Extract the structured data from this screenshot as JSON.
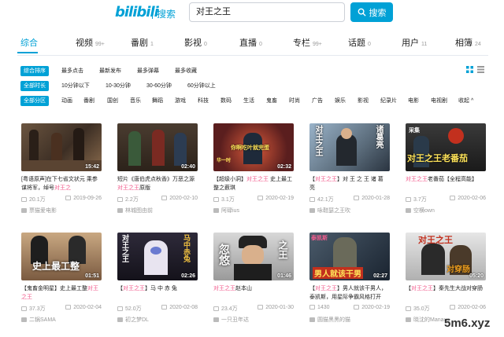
{
  "header": {
    "logo": "bilibili",
    "logo_sub": "搜索",
    "search_value": "对王之王",
    "search_button": "搜索"
  },
  "tabs": [
    {
      "label": "综合",
      "count": ""
    },
    {
      "label": "视频",
      "count": "99+"
    },
    {
      "label": "番剧",
      "count": "1"
    },
    {
      "label": "影视",
      "count": "0"
    },
    {
      "label": "直播",
      "count": "0"
    },
    {
      "label": "专栏",
      "count": "99+"
    },
    {
      "label": "话题",
      "count": "0"
    },
    {
      "label": "用户",
      "count": "11"
    },
    {
      "label": "相簿",
      "count": "24"
    }
  ],
  "filters": {
    "sort": [
      "综合排序",
      "最多点击",
      "最新发布",
      "最多弹幕",
      "最多收藏"
    ],
    "duration": [
      "全部时长",
      "10分钟以下",
      "10-30分钟",
      "30-60分钟",
      "60分钟以上"
    ],
    "zone": [
      "全部分区",
      "动画",
      "番剧",
      "国创",
      "音乐",
      "舞蹈",
      "游戏",
      "科技",
      "数码",
      "生活",
      "鬼畜",
      "时尚",
      "广告",
      "娱乐",
      "影视",
      "纪录片",
      "电影",
      "电视剧",
      "收起 ^"
    ]
  },
  "videos": [
    {
      "duration": "15:42",
      "title_pre": "[粤语原声]在下七省文状元 乘参谋将军，绰号",
      "title_hl": "对王之",
      "title_post": "",
      "views": "20.1万",
      "date": "2019-09-26",
      "uploader": "票猫爱电影",
      "overlay": ""
    },
    {
      "duration": "02:40",
      "title_pre": "短片《唐伯虎点秋香》万恶之源",
      "title_hl": "对王之王",
      "title_post": "原版",
      "views": "2.2万",
      "date": "2020-02-10",
      "uploader": "林城图由前",
      "overlay": "",
      "overlay2": ""
    },
    {
      "duration": "02:32",
      "title_pre": "【超级小洞】",
      "title_hl": "对王之王",
      "title_post": " 史上最工整之薮琪",
      "views": "3.1万",
      "date": "2020-02-19",
      "uploader": "阿碌ius",
      "overlay": "你啊吃叶就完蛋",
      "overlay2": "华一时"
    },
    {
      "duration": "",
      "title_pre": "【",
      "title_hl": "对王之王",
      "title_post": "】对 王 之 王 诸 葛 亮",
      "views": "42.1万",
      "date": "2020-01-28",
      "uploader": "咏鞋瑟之王吹",
      "overlay": "对王之王",
      "overlay2": "诸葛亮"
    },
    {
      "duration": "",
      "title_pre": "",
      "title_hl": "对王之王",
      "title_post": "老番茄【全程高能】",
      "views": "3.7万",
      "date": "2020-02-06",
      "uploader": "空横own",
      "overlay": "对王之王老番茄",
      "overlay2": "采集"
    },
    {
      "duration": "01:51",
      "title_pre": "【鬼畜金明星】史上最工整",
      "title_hl": "对王之王",
      "title_post": "",
      "views": "37.3万",
      "date": "2020-02-04",
      "uploader": "二锅SAMA",
      "overlay": "史上最工整"
    },
    {
      "duration": "02:26",
      "title_pre": "【",
      "title_hl": "对王之王",
      "title_post": "】马 中 赤 兔",
      "views": "52.0万",
      "date": "2020-02-08",
      "uploader": "初之梦DL",
      "overlay": "对王之王",
      "overlay2": "马中赤兔"
    },
    {
      "duration": "01:46",
      "title_pre": "",
      "title_hl": "对王之王",
      "title_post": "赵本山",
      "views": "23.4万",
      "date": "2020-01-30",
      "uploader": "一只丑年达",
      "overlay": "忽悠",
      "overlay2": "之王"
    },
    {
      "duration": "02:27",
      "title_pre": "【",
      "title_hl": "对王之王",
      "title_post": "】男人就该干男人，泰凯斯，用星际争霸风格打开",
      "views": "1430",
      "date": "2020-02-19",
      "uploader": "圆猫黑黑的猫",
      "overlay": "男人就该干男",
      "overlay2": "泰凯斯"
    },
    {
      "duration": "05:20",
      "title_pre": "【",
      "title_hl": "对王之王",
      "title_post": "】秦先生大战对穿肠",
      "views": "35.0万",
      "date": "2020-02-06",
      "uploader": "晓沈的Manaus",
      "overlay": "对王之王",
      "overlay2": "对穿肠"
    }
  ],
  "watermark": "5m6.xyz",
  "colors": {
    "accent": "#00a1d6",
    "highlight": "#f25d8e"
  }
}
